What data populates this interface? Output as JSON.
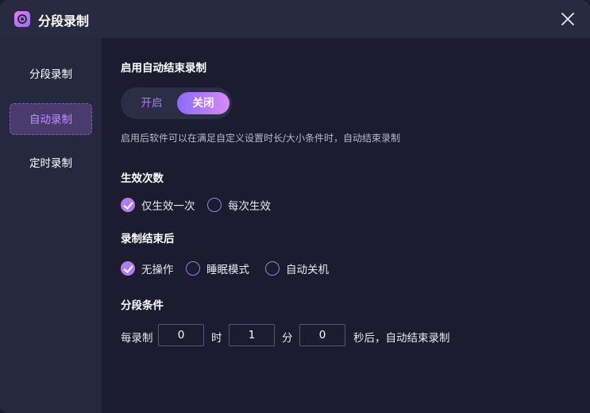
{
  "window": {
    "title": "分段录制"
  },
  "sidebar": {
    "items": [
      {
        "label": "分段录制"
      },
      {
        "label": "自动录制"
      },
      {
        "label": "定时录制"
      }
    ],
    "active_index": 1
  },
  "auto_end": {
    "title": "启用自动结束录制",
    "toggle": {
      "on_label": "开启",
      "off_label": "关闭",
      "selected": "关闭"
    },
    "hint": "启用后软件可以在满足自定义设置时长/大小条件时，自动结束录制"
  },
  "effect_times": {
    "title": "生效次数",
    "options": [
      {
        "label": "仅生效一次",
        "checked": true
      },
      {
        "label": "每次生效",
        "checked": false
      }
    ]
  },
  "after_record": {
    "title": "录制结束后",
    "options": [
      {
        "label": "无操作",
        "checked": true
      },
      {
        "label": "睡眠模式",
        "checked": false
      },
      {
        "label": "自动关机",
        "checked": false
      }
    ]
  },
  "segment": {
    "title": "分段条件",
    "prefix": "每录制",
    "hours": "0",
    "hour_unit": "时",
    "minutes": "1",
    "minute_unit": "分",
    "seconds": "0",
    "suffix": "秒后，自动结束录制"
  },
  "colors": {
    "accent": "#b27cf0",
    "background": "#1b1c30",
    "sidebar": "#26283f"
  }
}
